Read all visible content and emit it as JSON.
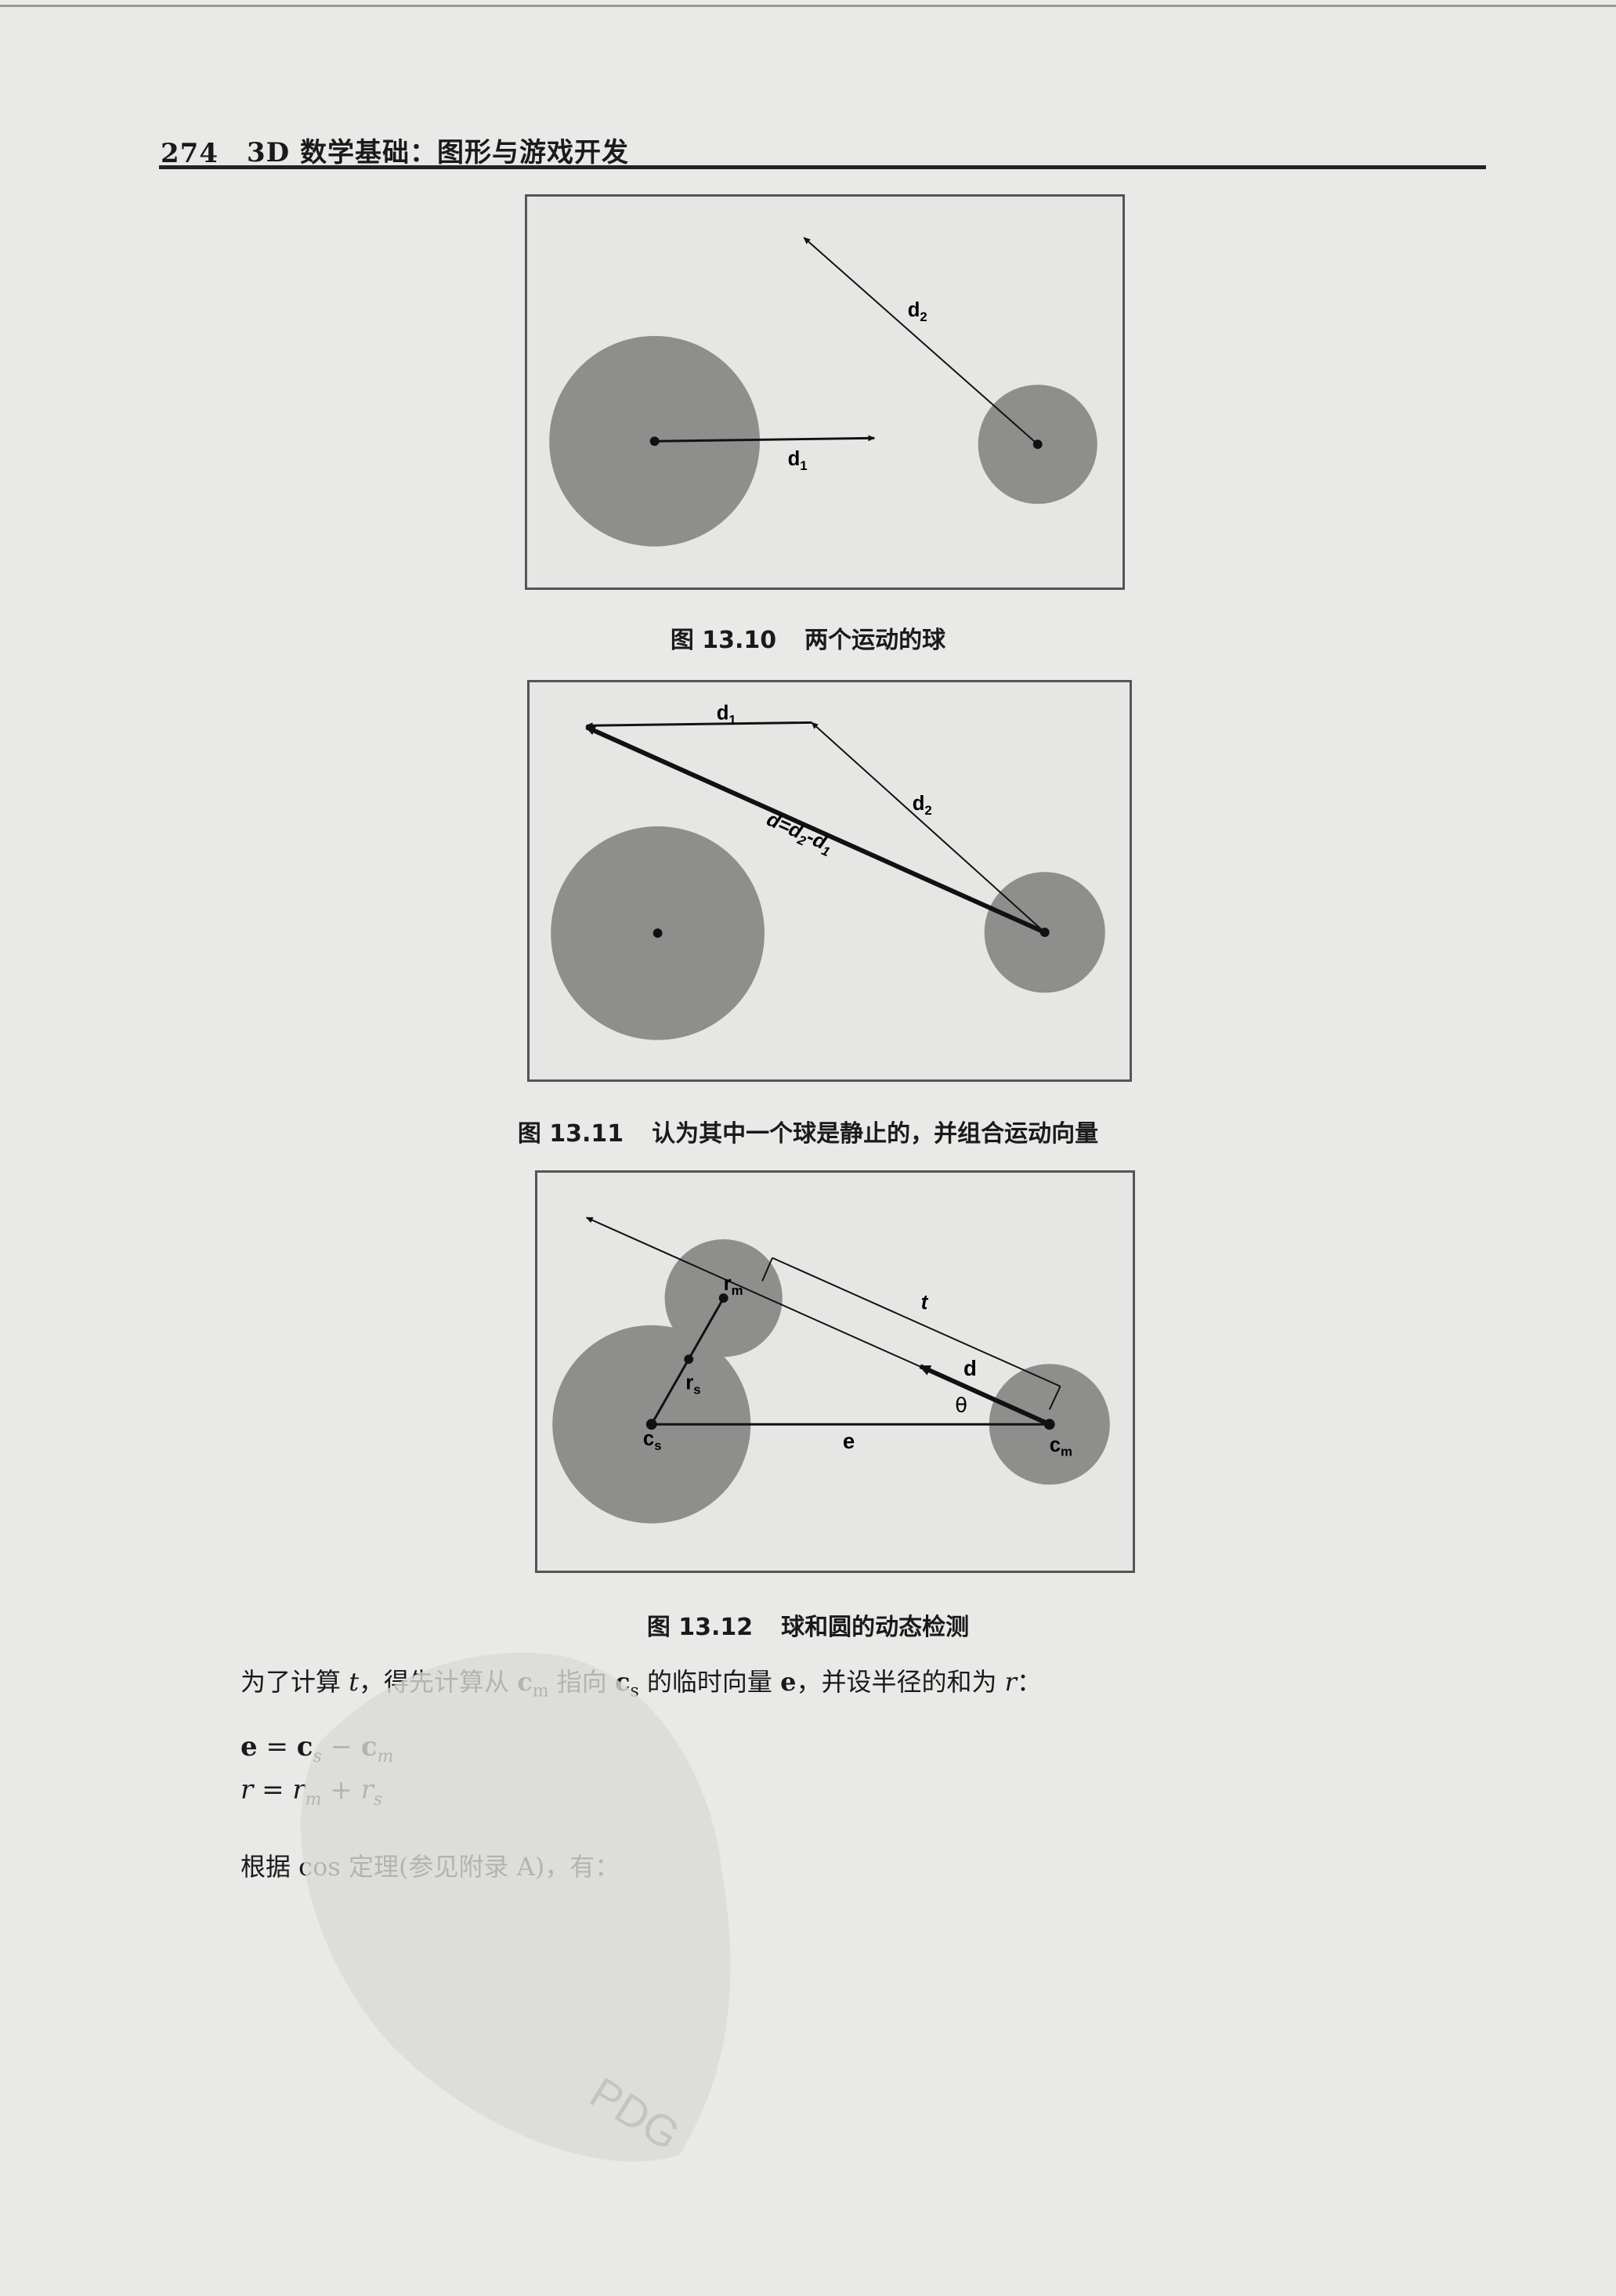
{
  "header": {
    "page_number": "274",
    "book_title": "3D 数学基础：图形与游戏开发"
  },
  "figures": [
    {
      "caption_number": "图 13.10",
      "caption_text": "两个运动的球",
      "labels": {
        "d1": "d",
        "d1_sub": "1",
        "d2": "d",
        "d2_sub": "2"
      }
    },
    {
      "caption_number": "图 13.11",
      "caption_text": "认为其中一个球是静止的，并组合运动向量",
      "labels": {
        "d1": "d",
        "d1_sub": "1",
        "d2": "d",
        "d2_sub": "2",
        "d_eq": "d=d",
        "d_eq_sub2": "2",
        "d_eq_minus": "-d",
        "d_eq_sub1": "1"
      }
    },
    {
      "caption_number": "图 13.12",
      "caption_text": "球和圆的动态检测",
      "labels": {
        "rm": "r",
        "rm_sub": "m",
        "rs": "r",
        "rs_sub": "s",
        "t": "t",
        "d": "d",
        "theta": "θ",
        "cs": "c",
        "cs_sub": "s",
        "e": "e",
        "cm": "c",
        "cm_sub": "m"
      }
    }
  ],
  "body": {
    "para1_a": "为了计算 ",
    "para1_t": "t",
    "para1_b": "，得先计算从 ",
    "para1_cm": "c",
    "para1_cm_sub": "m",
    "para1_c": " 指向 ",
    "para1_cs": "c",
    "para1_cs_sub": "s",
    "para1_d": " 的临时向量 ",
    "para1_e": "e",
    "para1_f": "，并设半径的和为 ",
    "para1_r": "r",
    "para1_g": "：",
    "eq1": {
      "lhs": "e",
      "eq": " = ",
      "a": "c",
      "a_sub": "s",
      "minus": " − ",
      "b": "c",
      "b_sub": "m"
    },
    "eq2": {
      "lhs": "r",
      "eq": " = ",
      "a": "r",
      "a_sub": "m",
      "plus": " + ",
      "b": "r",
      "b_sub": "s"
    },
    "para2": "根据 cos 定理(参见附录 A)，有："
  },
  "watermark": {
    "text": "PDG"
  }
}
